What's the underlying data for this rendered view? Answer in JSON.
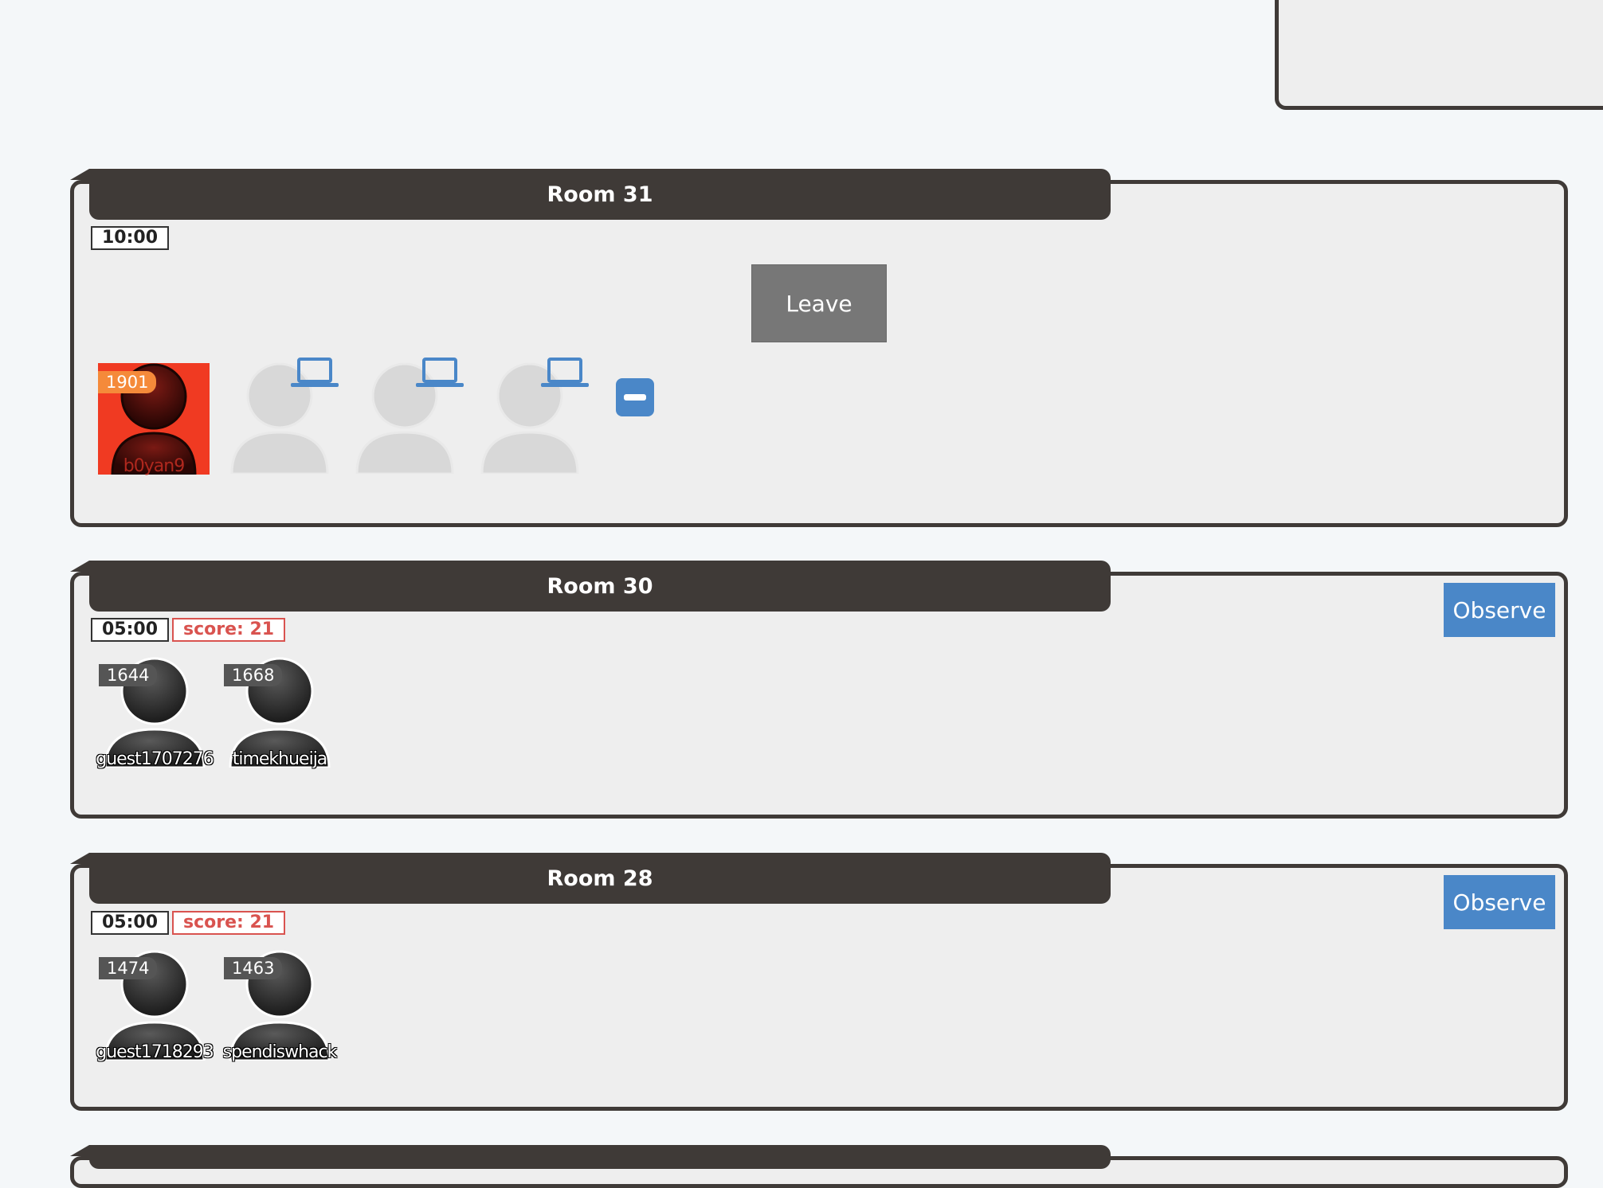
{
  "rooms": [
    {
      "title": "Room 31",
      "timer": "10:00",
      "leave_label": "Leave",
      "players": [
        {
          "rating": "1901",
          "name": "b0yan9"
        }
      ],
      "empty_seat_icon": "laptop-icon"
    },
    {
      "title": "Room 30",
      "timer": "05:00",
      "score": "score: 21",
      "observe_label": "Observe",
      "players": [
        {
          "rating": "1644",
          "name": "guest1707276"
        },
        {
          "rating": "1668",
          "name": "timekhueija"
        }
      ]
    },
    {
      "title": "Room 28",
      "timer": "05:00",
      "score": "score: 21",
      "observe_label": "Observe",
      "players": [
        {
          "rating": "1474",
          "name": "guest1718293"
        },
        {
          "rating": "1463",
          "name": "spendiswhack"
        }
      ]
    }
  ],
  "colors": {
    "header": "#3f3a37",
    "accent": "#4a87c8",
    "self_player": "#f03a22",
    "score": "#d9534f"
  }
}
